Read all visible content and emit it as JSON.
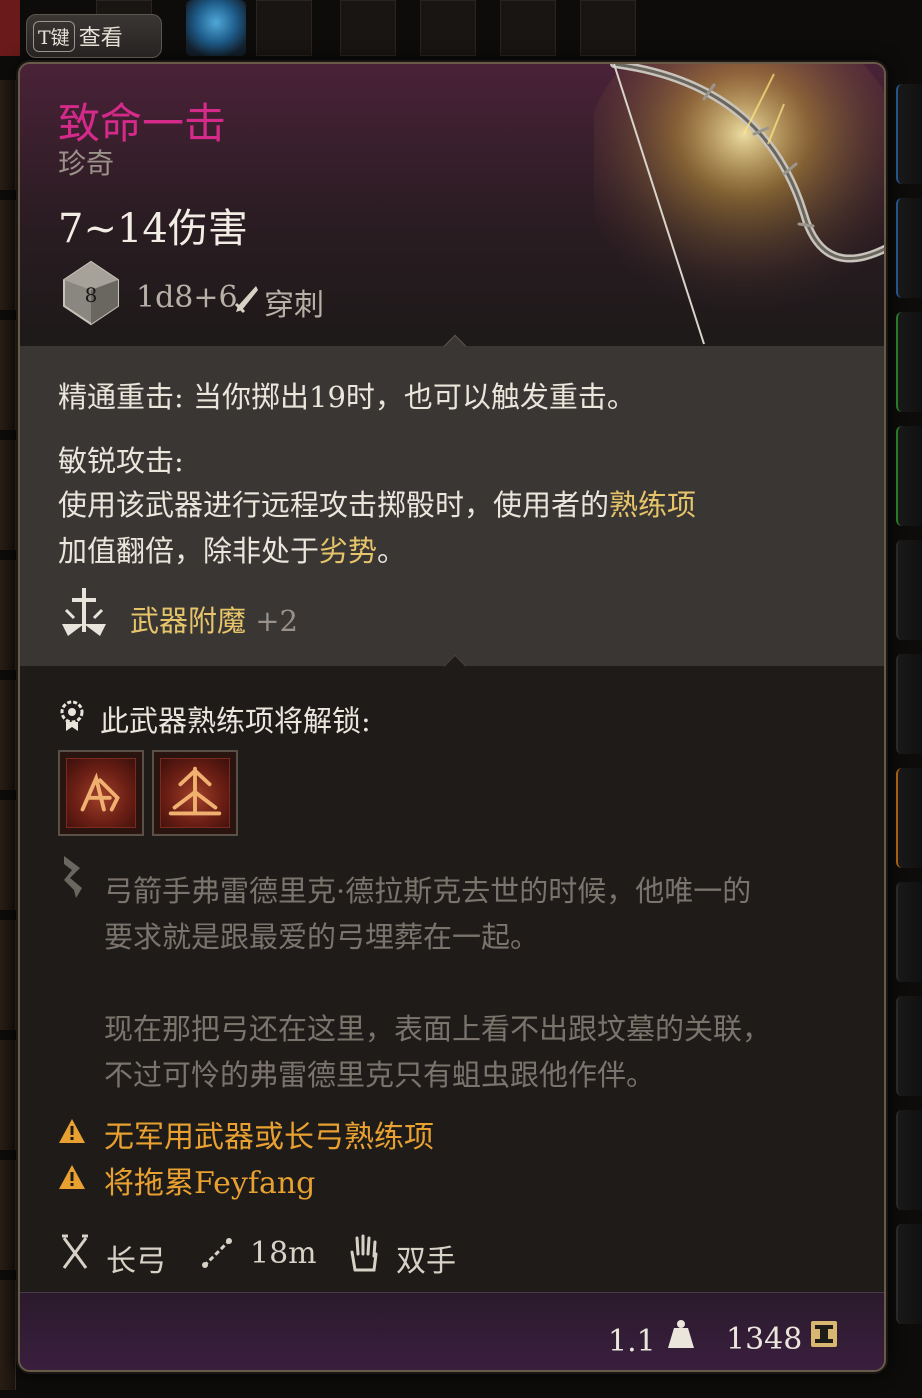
{
  "hotkey": {
    "key": "T键",
    "label": "查看"
  },
  "item": {
    "name": "致命一击",
    "rarity": "珍奇",
    "damage": "7~14伤害",
    "dice": "1d8+6",
    "die_face": "8",
    "damage_type": "穿刺"
  },
  "effects": {
    "mastery_name": "精通重击:",
    "mastery_text": "当你掷出19时，也可以触发重击。",
    "keen_title": "敏锐攻击:",
    "keen_line1_a": "使用该武器进行远程攻击掷骰时，使用者的",
    "keen_line1_b": "熟练项",
    "keen_line2_a": "加值翻倍，除非处于",
    "keen_line2_b": "劣势",
    "keen_line2_c": "。",
    "enchant_label": "武器附魔",
    "enchant_value": "+2"
  },
  "proficiency": {
    "header": "此武器熟练项将解锁:",
    "actions": [
      "slot-action-1",
      "slot-action-2"
    ]
  },
  "lore": [
    "弓箭手弗雷德里克·德拉斯克去世的时候，他唯一的",
    "要求就是跟最爱的弓埋葬在一起。",
    "现在那把弓还在这里，表面上看不出跟坟墓的关联，",
    "不过可怜的弗雷德里克只有蛆虫跟他作伴。"
  ],
  "warnings": [
    "无军用武器或长弓熟练项",
    "将拖累Feyfang"
  ],
  "stats": {
    "weapon_type": "长弓",
    "range": "18m",
    "handedness": "双手"
  },
  "footer": {
    "weight": "1.1",
    "price": "1348"
  },
  "colors": {
    "rarity_name": "#d42a8a",
    "warning": "#e8a030",
    "highlight": "#e6c46a"
  },
  "icons": [
    "d8-die-icon",
    "pierce-icon",
    "enchant-icon",
    "proficiency-icon",
    "lore-icon",
    "warning-icon",
    "weapon-type-icon",
    "range-icon",
    "hand-icon",
    "weight-icon",
    "gold-icon"
  ]
}
